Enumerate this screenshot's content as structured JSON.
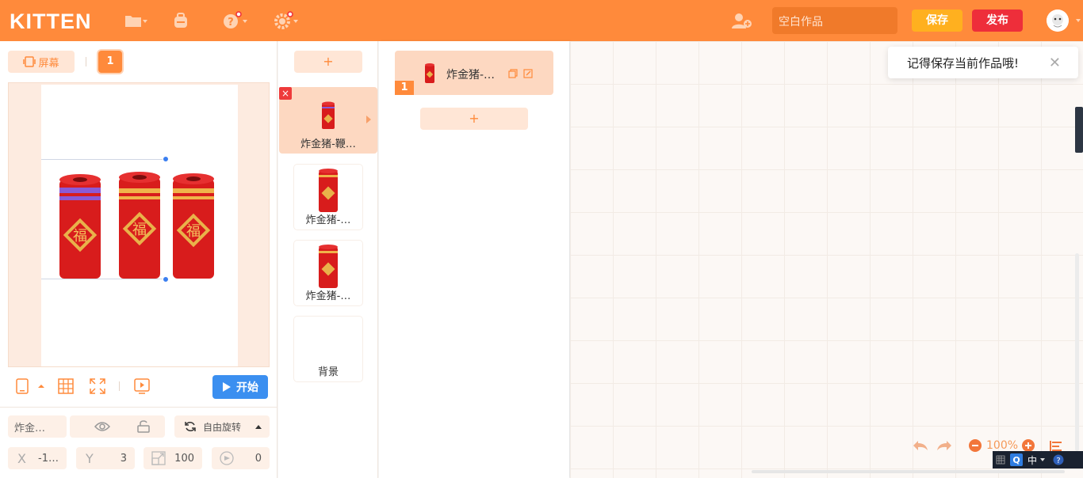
{
  "app": {
    "logo": "KITTEN"
  },
  "header": {
    "project_name": "空白作品",
    "save_label": "保存",
    "publish_label": "发布"
  },
  "left": {
    "screen_label": "屏幕",
    "screen_number": "1",
    "start_label": "开始",
    "props": {
      "name": "炸金…",
      "rotation_mode": "自由旋转",
      "x_label": "X",
      "x_value": "-1…",
      "y_label": "Y",
      "y_value": "3",
      "scale_value": "100",
      "direction_value": "0"
    }
  },
  "sprites": {
    "add_label": "+",
    "items": [
      {
        "name": "炸金猪-鞭…",
        "active": true,
        "delete_label": "×"
      },
      {
        "name": "炸金猪-…",
        "active": false
      },
      {
        "name": "炸金猪-…",
        "active": false
      },
      {
        "name": "背景",
        "active": false
      }
    ]
  },
  "scripts": {
    "card_title": "炸金猪-…",
    "card_number": "1",
    "add_label": "+"
  },
  "canvas": {
    "toast_message": "记得保存当前作品哦!",
    "toast_close": "✕",
    "zoom": "100%"
  },
  "taskbar": {
    "ime": "中"
  },
  "colors": {
    "brand": "#ff8a3b",
    "save": "#ffb01f",
    "publish": "#ee2e3a",
    "start": "#3b8ff0"
  }
}
